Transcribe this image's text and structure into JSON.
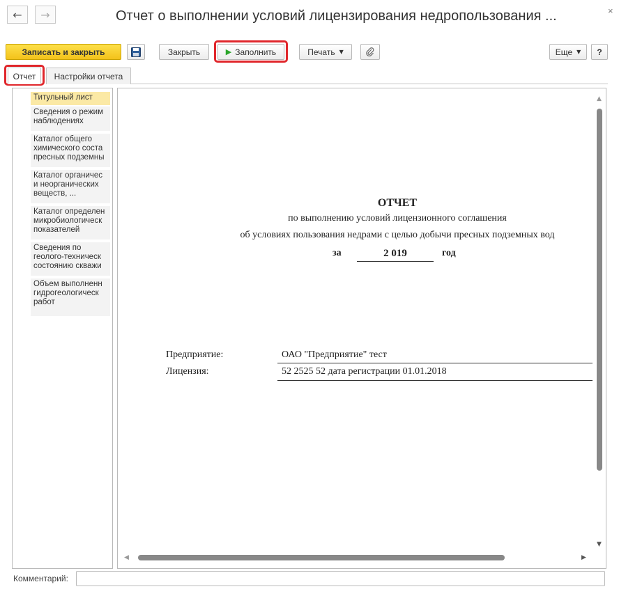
{
  "window": {
    "title": "Отчет о выполнении условий лицензирования недропользования ...",
    "back_icon": "←",
    "forward_icon": "→",
    "close_icon": "×"
  },
  "toolbar": {
    "save_close_label": "Записать и закрыть",
    "close_label": "Закрыть",
    "fill_label": "Заполнить",
    "print_label": "Печать",
    "more_label": "Еще",
    "help_label": "?"
  },
  "tabs": [
    "Отчет",
    "Настройки отчета"
  ],
  "sections": [
    "Титульный лист",
    "Сведения о режим\nнаблюдениях",
    "Каталог общего\nхимического соста\nпресных подземны",
    "Каталог органичес\nи неорганических\nвеществ, ...",
    "Каталог определен\nмикробиологическ\nпоказателей",
    "Сведения по\nгеолого-техническ\nсостоянию скважи",
    "Объем выполненн\nгидрогеологическ\nработ"
  ],
  "report": {
    "heading": "ОТЧЕТ",
    "line1": "по выполнению условий лицензионного соглашения",
    "line2": "об условиях пользования недрами с целью добычи пресных подземных вод",
    "year_prefix": "за",
    "year": "2 019",
    "year_suffix": "год",
    "enterprise_label": "Предприятие:",
    "enterprise_value": "ОАО \"Предприятие\" тест",
    "license_label": "Лицензия:",
    "license_value": "52 2525 52 дата регистрации 01.01.2018"
  },
  "comment": {
    "label": "Комментарий:",
    "value": ""
  },
  "colors": {
    "primary": "#f3c21a",
    "highlight": "#e0262b",
    "active_section": "#fbe9a5",
    "play_icon": "#2aa52a"
  }
}
